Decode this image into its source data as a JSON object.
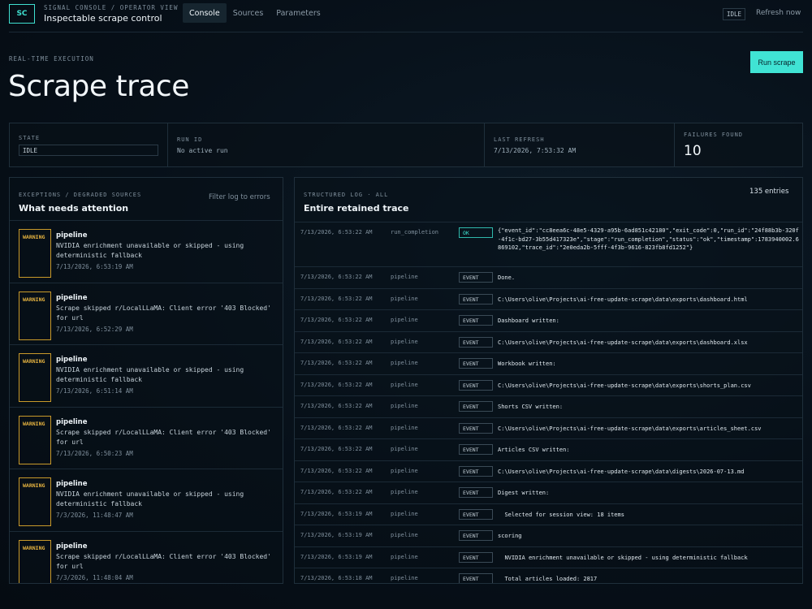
{
  "header": {
    "logo": "SC",
    "subtitle": "SIGNAL CONSOLE / OPERATOR VIEW",
    "title": "Inspectable scrape control",
    "nav": [
      "Console",
      "Sources",
      "Parameters"
    ],
    "status_chip": "IDLE",
    "refresh_label": "Refresh now"
  },
  "hero": {
    "eyebrow": "REAL-TIME EXECUTION",
    "title": "Scrape trace",
    "run_button": "Run scrape"
  },
  "stats": {
    "state_label": "STATE",
    "state_value": "IDLE",
    "run_id_label": "RUN ID",
    "run_id_value": "No active run",
    "last_refresh_label": "LAST REFRESH",
    "last_refresh_value": "7/13/2026, 7:53:32 AM",
    "failures_label": "FAILURES FOUND",
    "failures_value": "10"
  },
  "exceptions": {
    "eyebrow": "EXCEPTIONS / DEGRADED SOURCES",
    "title": "What needs attention",
    "filter_link": "Filter log to errors",
    "items": [
      {
        "badge": "WARNING",
        "source": "pipeline",
        "message": "NVIDIA enrichment unavailable or skipped - using deterministic fallback",
        "time": "7/13/2026, 6:53:19 AM"
      },
      {
        "badge": "WARNING",
        "source": "pipeline",
        "message": "Scrape skipped r/LocalLLaMA: Client error '403 Blocked' for url",
        "time": "7/13/2026, 6:52:29 AM"
      },
      {
        "badge": "WARNING",
        "source": "pipeline",
        "message": "NVIDIA enrichment unavailable or skipped - using deterministic fallback",
        "time": "7/13/2026, 6:51:14 AM"
      },
      {
        "badge": "WARNING",
        "source": "pipeline",
        "message": "Scrape skipped r/LocalLLaMA: Client error '403 Blocked' for url",
        "time": "7/13/2026, 6:50:23 AM"
      },
      {
        "badge": "WARNING",
        "source": "pipeline",
        "message": "NVIDIA enrichment unavailable or skipped - using deterministic fallback",
        "time": "7/3/2026, 11:48:47 AM"
      },
      {
        "badge": "WARNING",
        "source": "pipeline",
        "message": "Scrape skipped r/LocalLLaMA: Client error '403 Blocked' for url",
        "time": "7/3/2026, 11:48:04 AM"
      }
    ]
  },
  "log": {
    "eyebrow": "STRUCTURED LOG · ALL",
    "title": "Entire retained trace",
    "count": "135 entries",
    "rows": [
      {
        "time": "7/13/2026, 6:53:22 AM",
        "source": "run_completion",
        "tag": "OK",
        "message": "{\"event_id\":\"cc8eea6c-48e5-4329-a95b-6ad851c42180\",\"exit_code\":0,\"run_id\":\"24f88b3b-320f-4f1c-bd27-3b55d417323e\",\"stage\":\"run_completion\",\"status\":\"ok\",\"timestamp\":1783940002.6869102,\"trace_id\":\"2e0eda2b-5fff-4f3b-9616-823fb8fd1252\"}"
      },
      {
        "time": "7/13/2026, 6:53:22 AM",
        "source": "pipeline",
        "tag": "EVENT",
        "message": "Done."
      },
      {
        "time": "7/13/2026, 6:53:22 AM",
        "source": "pipeline",
        "tag": "EVENT",
        "message": "C:\\Users\\olive\\Projects\\ai-free-update-scrape\\data\\exports\\dashboard.html"
      },
      {
        "time": "7/13/2026, 6:53:22 AM",
        "source": "pipeline",
        "tag": "EVENT",
        "message": "Dashboard written:"
      },
      {
        "time": "7/13/2026, 6:53:22 AM",
        "source": "pipeline",
        "tag": "EVENT",
        "message": "C:\\Users\\olive\\Projects\\ai-free-update-scrape\\data\\exports\\dashboard.xlsx"
      },
      {
        "time": "7/13/2026, 6:53:22 AM",
        "source": "pipeline",
        "tag": "EVENT",
        "message": "Workbook written:"
      },
      {
        "time": "7/13/2026, 6:53:22 AM",
        "source": "pipeline",
        "tag": "EVENT",
        "message": "C:\\Users\\olive\\Projects\\ai-free-update-scrape\\data\\exports\\shorts_plan.csv"
      },
      {
        "time": "7/13/2026, 6:53:22 AM",
        "source": "pipeline",
        "tag": "EVENT",
        "message": "Shorts CSV written:"
      },
      {
        "time": "7/13/2026, 6:53:22 AM",
        "source": "pipeline",
        "tag": "EVENT",
        "message": "C:\\Users\\olive\\Projects\\ai-free-update-scrape\\data\\exports\\articles_sheet.csv"
      },
      {
        "time": "7/13/2026, 6:53:22 AM",
        "source": "pipeline",
        "tag": "EVENT",
        "message": "Articles CSV written:"
      },
      {
        "time": "7/13/2026, 6:53:22 AM",
        "source": "pipeline",
        "tag": "EVENT",
        "message": "C:\\Users\\olive\\Projects\\ai-free-update-scrape\\data\\digests\\2026-07-13.md"
      },
      {
        "time": "7/13/2026, 6:53:22 AM",
        "source": "pipeline",
        "tag": "EVENT",
        "message": "Digest written:"
      },
      {
        "time": "7/13/2026, 6:53:19 AM",
        "source": "pipeline",
        "tag": "EVENT",
        "message": "  Selected for session view: 18 items"
      },
      {
        "time": "7/13/2026, 6:53:19 AM",
        "source": "pipeline",
        "tag": "EVENT",
        "message": "scoring"
      },
      {
        "time": "7/13/2026, 6:53:19 AM",
        "source": "pipeline",
        "tag": "EVENT",
        "message": "  NVIDIA enrichment unavailable or skipped - using deterministic fallback"
      },
      {
        "time": "7/13/2026, 6:53:18 AM",
        "source": "pipeline",
        "tag": "EVENT",
        "message": "  Total articles loaded: 2817"
      }
    ]
  },
  "colors": {
    "accent": "#40e3d4",
    "warning": "#e6b340",
    "background": "#071019"
  }
}
